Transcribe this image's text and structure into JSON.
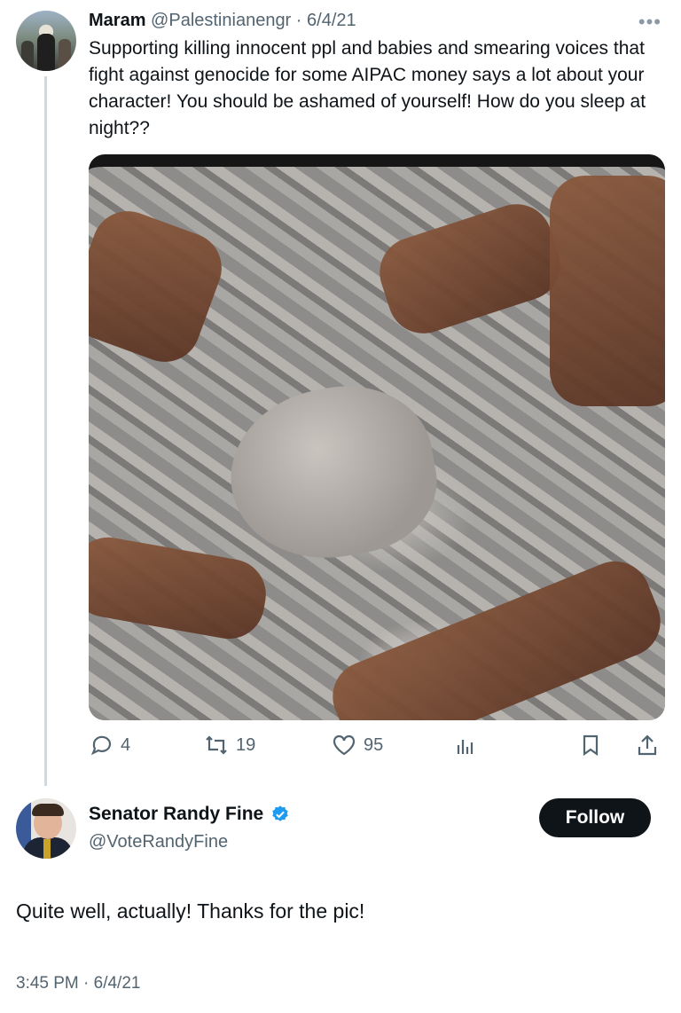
{
  "parent_tweet": {
    "author_name": "Maram",
    "author_handle": "@Palestinianengr",
    "separator": " · ",
    "date": "6/4/21",
    "text": "Supporting killing innocent ppl and babies and smearing voices that fight against genocide for some AIPAC money says a lot about your character! You should be ashamed of yourself! How do you sleep at night??",
    "actions": {
      "replies": "4",
      "retweets": "19",
      "likes": "95"
    }
  },
  "reply_tweet": {
    "author_name": "Senator Randy Fine",
    "author_handle": "@VoteRandyFine",
    "follow_label": "Follow",
    "text": "Quite well, actually!  Thanks for the pic!",
    "timestamp": "3:45 PM · 6/4/21"
  },
  "colors": {
    "text_primary": "#0f1419",
    "text_secondary": "#536471",
    "verified": "#1d9bf0",
    "follow_bg": "#0f1419"
  },
  "icons": [
    "more-icon",
    "reply-icon",
    "retweet-icon",
    "like-icon",
    "views-icon",
    "bookmark-icon",
    "share-icon",
    "verified-icon"
  ]
}
